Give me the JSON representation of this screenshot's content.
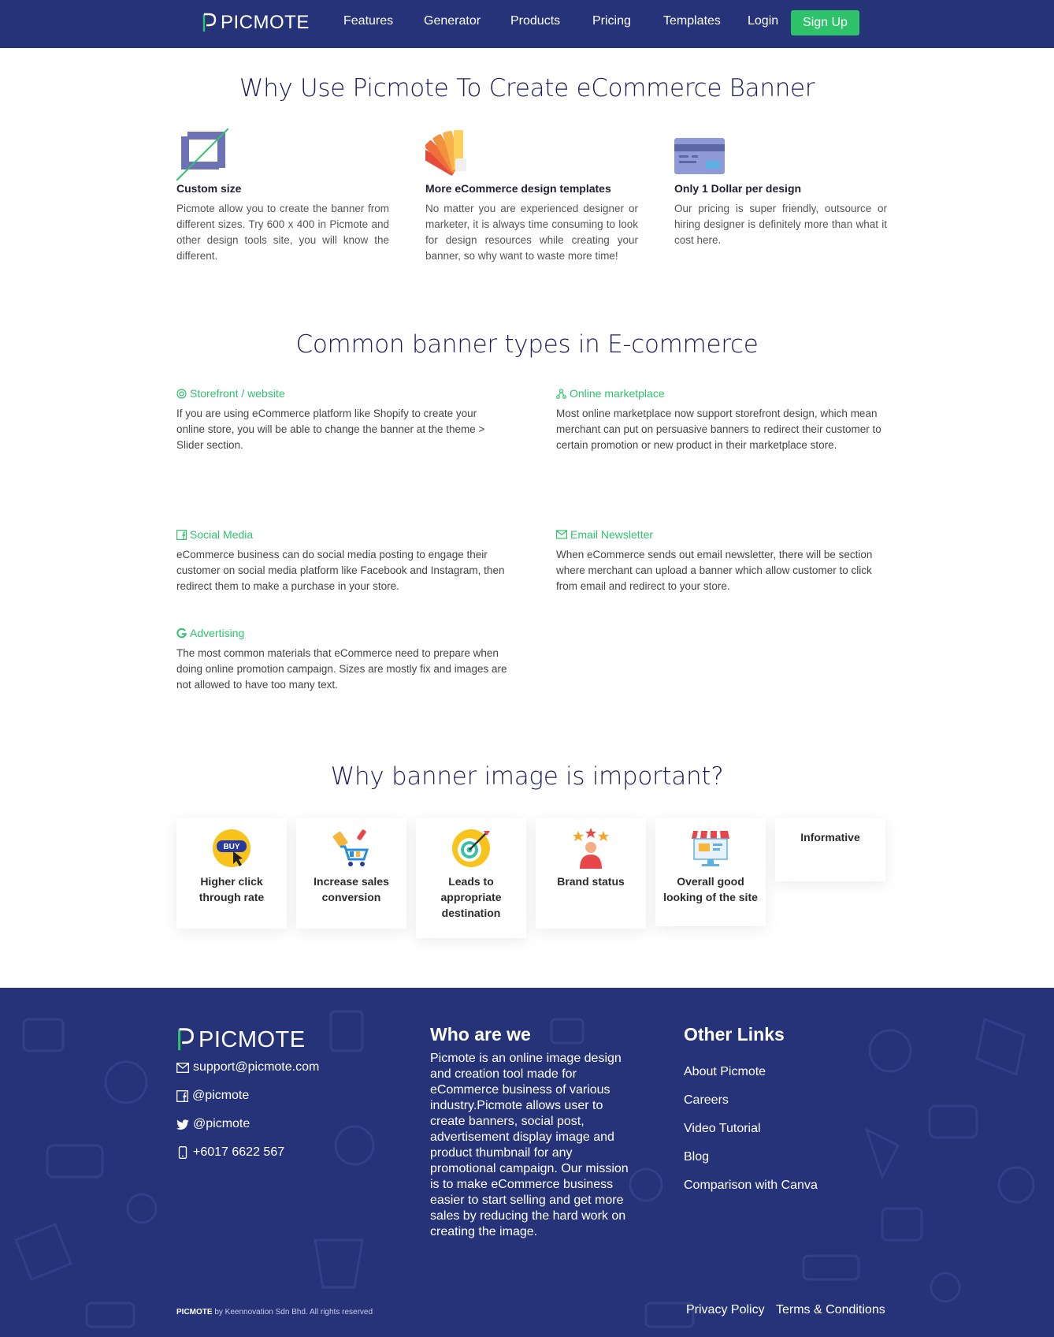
{
  "nav": {
    "logo": "PICMOTE",
    "links": [
      "Features",
      "Generator",
      "Products",
      "Pricing",
      "Templates",
      "Login"
    ],
    "signup": "Sign Up"
  },
  "why_use": {
    "title": "Why Use Picmote To Create eCommerce Banner",
    "features": [
      {
        "icon": "crop-icon",
        "title": "Custom size",
        "desc": "Picmote allow you to create the banner from different sizes. Try 600 x 400 in Picmote and other design tools site, you will know the different."
      },
      {
        "icon": "color-swatch-icon",
        "title": "More eCommerce design templates",
        "desc": "No matter you are experienced designer or marketer, it is always time consuming to look for design resources while creating your banner, so why want to waste more time!"
      },
      {
        "icon": "credit-card-icon",
        "title": "Only 1 Dollar per design",
        "desc": "Our pricing is super friendly, outsource or hiring designer is definitely more than what it cost here."
      }
    ]
  },
  "banner_types": {
    "title": "Common banner types in E-commerce",
    "items": [
      {
        "icon": "storefront-icon",
        "title": "Storefront / website",
        "desc": "If you are using eCommerce platform like Shopify to create your online store, you will be able to change the banner at the theme > Slider section."
      },
      {
        "icon": "marketplace-icon",
        "title": "Online marketplace",
        "desc": "Most online marketplace now support storefront design, which mean merchant can put on persuasive banners to redirect their customer to certain promotion or new product in their marketplace store."
      },
      {
        "icon": "facebook-icon",
        "title": "Social Media",
        "desc": "eCommerce business can do social media posting to engage their customer on social media platform like Facebook and Instagram, then redirect them to make a purchase in your store."
      },
      {
        "icon": "email-icon",
        "title": "Email Newsletter",
        "desc": "When eCommerce sends out email newsletter, there will be section where merchant can upload a banner which allow customer to click from email and redirect to your store."
      },
      {
        "icon": "google-icon",
        "title": "Advertising",
        "desc": "The most common materials that eCommerce need to prepare when doing online promotion campaign. Sizes are mostly fix and images are not allowed to have too many text."
      }
    ]
  },
  "importance": {
    "title": "Why banner image is important?",
    "cards": [
      {
        "icon": "buy-button-icon",
        "label": "Higher click through rate",
        "buy_text": "BUY"
      },
      {
        "icon": "shopping-cart-icon",
        "label": "Increase sales conversion"
      },
      {
        "icon": "target-icon",
        "label": "Leads to appropriate destination"
      },
      {
        "icon": "star-person-icon",
        "label": "Brand status"
      },
      {
        "icon": "shop-screen-icon",
        "label": "Overall good looking of the site"
      },
      {
        "icon": "",
        "label": "Informative"
      }
    ]
  },
  "footer": {
    "logo": "PICMOTE",
    "contacts": [
      {
        "icon": "email-icon",
        "text": "support@picmote.com"
      },
      {
        "icon": "facebook-icon",
        "text": "@picmote"
      },
      {
        "icon": "twitter-icon",
        "text": "@picmote"
      },
      {
        "icon": "phone-icon",
        "text": "+6017 6622 567"
      }
    ],
    "who_title": "Who are we",
    "who_text": "Picmote is an online image design and creation tool made for eCommerce business of various industry.Picmote allows user to create banners, social post, advertisement display image and product thumbnail for any promotional campaign. Our mission is to make eCommerce business easier to start selling and get more sales by reducing the hard work on creating the image.",
    "links_title": "Other Links",
    "links": [
      "About Picmote",
      "Careers",
      "Video Tutorial",
      "Blog",
      "Comparison with Canva"
    ],
    "copyright_brand": "PICMOTE",
    "copyright_rest": " by Keennovation Sdn Bhd. All rights reserved",
    "privacy": "Privacy Policy",
    "terms": "Terms & Conditions"
  },
  "colors": {
    "nav_bg": "#263379",
    "accent_green": "#2ec36b",
    "heading": "#1d1e5a"
  }
}
